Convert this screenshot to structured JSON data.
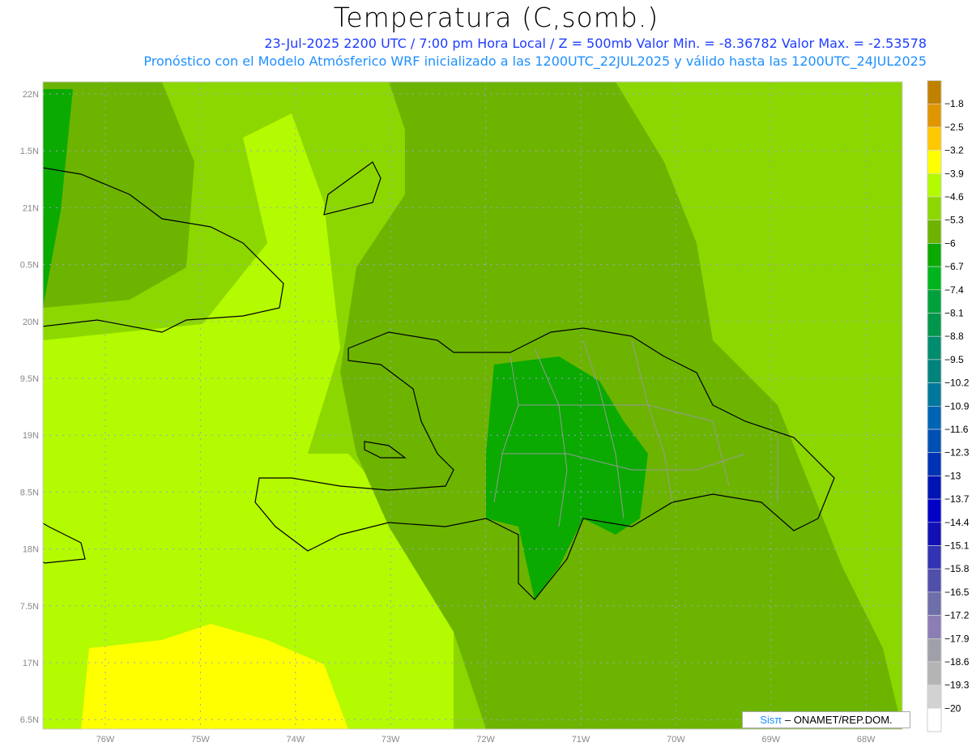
{
  "chart_data": {
    "type": "heatmap",
    "title": "Temperatura (C,somb.)",
    "subtitle_1": "23-Jul-2025   2200 UTC / 7:00 pm Hora Local / Z = 500mb  Valor Min. = -8.36782  Valor Max. = -2.53578",
    "subtitle_2": "Pronóstico con el Modelo Atmósferico WRF inicializado a las 1200UTC_22JUL2025 y válido hasta las  1200UTC_24JUL2025",
    "variable": "Temperature at 500mb (C)",
    "value_min": -8.36782,
    "value_max": -2.53578,
    "x_ticks": [
      "76W",
      "75W",
      "74W",
      "73W",
      "72W",
      "71W",
      "70W",
      "69W",
      "68W"
    ],
    "y_ticks": [
      "22N",
      "1.5N",
      "21N",
      "0.5N",
      "20N",
      "9.5N",
      "19N",
      "8.5N",
      "18N",
      "7.5N",
      "17N",
      "6.5N"
    ],
    "lon_range": [
      -76.65,
      -67.6
    ],
    "lat_range": [
      16.4,
      22.1
    ],
    "colorbar": {
      "labels": [
        "-1.8",
        "-2.5",
        "-3.2",
        "-3.9",
        "-4.6",
        "-5.3",
        "-6",
        "-6.7",
        "-7.4",
        "-8.1",
        "-8.8",
        "-9.5",
        "-10.2",
        "-10.9",
        "-11.6",
        "-12.3",
        "-13",
        "-13.7",
        "-14.4",
        "-15.1",
        "-15.8",
        "-16.5",
        "-17.2",
        "-17.9",
        "-18.6",
        "-19.3",
        "-20"
      ],
      "colors": [
        "#c08000",
        "#e09600",
        "#ffc800",
        "#ffff00",
        "#b4fa00",
        "#8cd700",
        "#6cb400",
        "#0aaa00",
        "#00b41e",
        "#00a03c",
        "#00964b",
        "#008c6e",
        "#00827d",
        "#00789b",
        "#0064b4",
        "#0050b4",
        "#0032b4",
        "#0014b4",
        "#0000c8",
        "#1010b4",
        "#3232b4",
        "#5050aa",
        "#6e6eaa",
        "#8c7db4",
        "#a0a0aa",
        "#b4b4b4",
        "#d2d2d2",
        "#ffffff"
      ]
    },
    "field_summary": "Mostly -6 to -4.6 C over the region; -3.9 to -3.2 in the southwest; locally -6.7 to -7.4 over central Dominican Republic"
  },
  "credit": {
    "brand": "Sisπ",
    "text": " –  ONAMET/REP.DOM."
  }
}
